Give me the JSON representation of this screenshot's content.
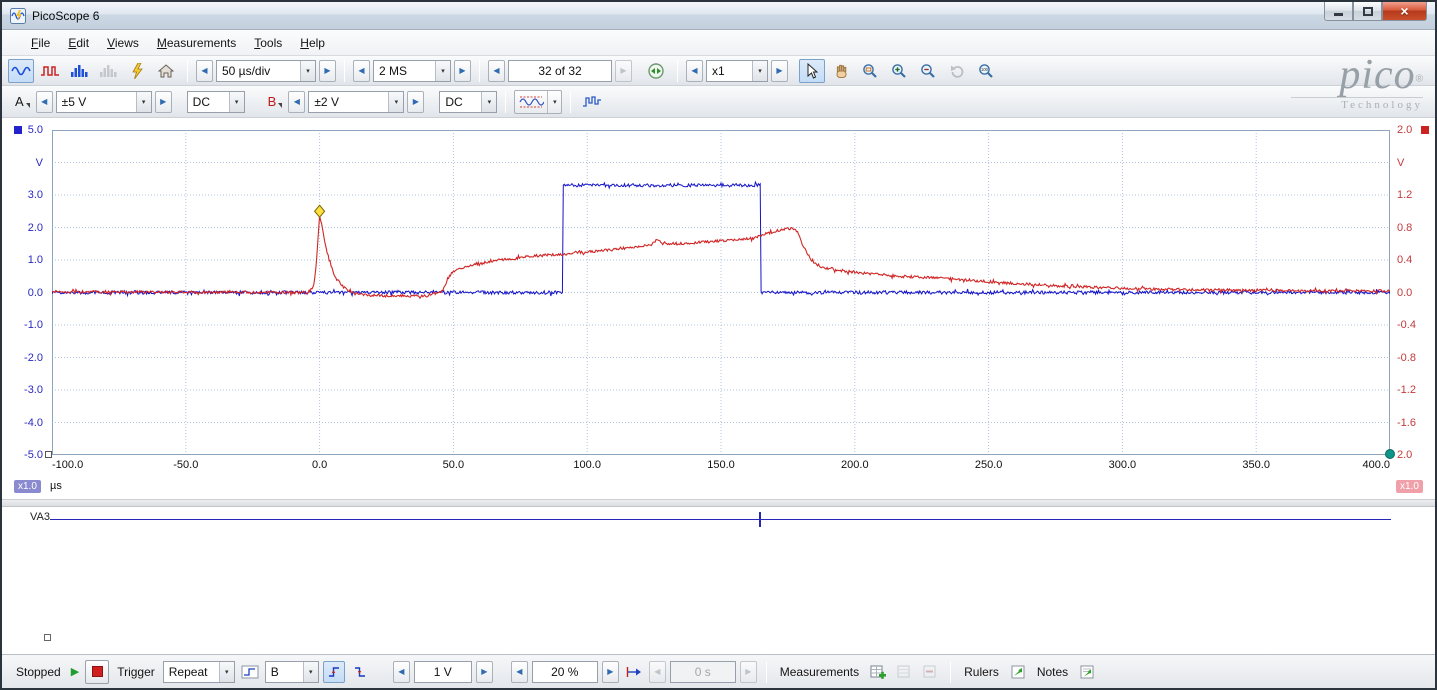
{
  "window": {
    "title": "PicoScope 6"
  },
  "icons": {
    "arrow_left": "◀",
    "arrow_right": "▶",
    "caret_down": "▾",
    "play": "▶",
    "close": "×"
  },
  "menu": {
    "items": [
      {
        "label": "File"
      },
      {
        "label": "Edit"
      },
      {
        "label": "Views"
      },
      {
        "label": "Measurements"
      },
      {
        "label": "Tools"
      },
      {
        "label": "Help"
      }
    ]
  },
  "toolbar": {
    "timebase": "50 µs/div",
    "samples": "2 MS",
    "buffer": "32 of 32",
    "zoom": "x1"
  },
  "channels": {
    "a": {
      "label": "A",
      "range": "±5 V",
      "coupling": "DC"
    },
    "b": {
      "label": "B",
      "range": "±2 V",
      "coupling": "DC"
    }
  },
  "logo": {
    "brand": "pico",
    "reg": "®",
    "sub": "Technology"
  },
  "scope": {
    "x_labels": [
      "-100.0",
      "-50.0",
      "0.0",
      "50.0",
      "100.0",
      "150.0",
      "200.0",
      "250.0",
      "300.0",
      "350.0",
      "400.0"
    ],
    "x_unit": "µs",
    "left_axis_labels": [
      "5.0",
      "V",
      "3.0",
      "2.0",
      "1.0",
      "0.0",
      "-1.0",
      "-2.0",
      "-3.0",
      "-4.0",
      "-5.0"
    ],
    "right_axis_labels": [
      "2.0",
      "V",
      "1.2",
      "0.8",
      "0.4",
      "0.0",
      "-0.4",
      "-0.8",
      "-1.2",
      "-1.6",
      "2.0"
    ],
    "zoom_badge_left": "x1.0",
    "zoom_badge_right": "x1.0"
  },
  "overview": {
    "label": "VA3"
  },
  "bottombar": {
    "status": "Stopped",
    "trigger_label": "Trigger",
    "trigger_mode": "Repeat",
    "trigger_source": "B",
    "trigger_level": "1 V",
    "pretrigger": "20 %",
    "holdoff": "0 s",
    "measurements_label": "Measurements",
    "rulers_label": "Rulers",
    "notes_label": "Notes"
  },
  "chart_data": {
    "type": "line",
    "title": "",
    "x_axis": {
      "label": "µs",
      "min": -100,
      "max": 400,
      "tick_step": 50,
      "divisions": 10
    },
    "y_axis_left": {
      "label": "V",
      "min": -5,
      "max": 5,
      "tick_step": 1,
      "color": "#2222cc"
    },
    "y_axis_right": {
      "label": "V",
      "min": -2,
      "max": 2,
      "tick_step": 0.4,
      "color": "#cc2222"
    },
    "grid": true,
    "series": [
      {
        "name": "Channel A",
        "axis": "left",
        "color": "#1414c8",
        "width": 1,
        "interpolation": "step",
        "noise": 0.05,
        "points": [
          [
            -100,
            0
          ],
          [
            91,
            0
          ],
          [
            91,
            3.3
          ],
          [
            165,
            3.3
          ],
          [
            165,
            0
          ],
          [
            400,
            0
          ]
        ]
      },
      {
        "name": "Channel B",
        "axis": "right",
        "color": "#d02525",
        "width": 1.1,
        "interpolation": "linear",
        "noise": 0.016,
        "points": [
          [
            -100,
            0.01
          ],
          [
            -4,
            0
          ],
          [
            -2,
            0.1
          ],
          [
            -1,
            0.45
          ],
          [
            0,
            0.95
          ],
          [
            1,
            0.8
          ],
          [
            2,
            0.6
          ],
          [
            4,
            0.35
          ],
          [
            6,
            0.18
          ],
          [
            9,
            0.06
          ],
          [
            12,
            0
          ],
          [
            16,
            -0.03
          ],
          [
            25,
            -0.04
          ],
          [
            40,
            -0.04
          ],
          [
            46,
            0.02
          ],
          [
            48,
            0.18
          ],
          [
            50,
            0.26
          ],
          [
            53,
            0.3
          ],
          [
            58,
            0.35
          ],
          [
            68,
            0.4
          ],
          [
            80,
            0.45
          ],
          [
            91,
            0.47
          ],
          [
            106,
            0.52
          ],
          [
            124,
            0.58
          ],
          [
            126,
            0.66
          ],
          [
            128,
            0.6
          ],
          [
            134,
            0.6
          ],
          [
            143,
            0.62
          ],
          [
            152,
            0.64
          ],
          [
            162,
            0.67
          ],
          [
            166,
            0.72
          ],
          [
            170,
            0.75
          ],
          [
            174,
            0.78
          ],
          [
            177,
            0.79
          ],
          [
            179,
            0.72
          ],
          [
            180,
            0.62
          ],
          [
            182,
            0.5
          ],
          [
            184,
            0.38
          ],
          [
            188,
            0.31
          ],
          [
            195,
            0.27
          ],
          [
            205,
            0.23
          ],
          [
            217,
            0.2
          ],
          [
            236,
            0.17
          ],
          [
            255,
            0.12
          ],
          [
            277,
            0.08
          ],
          [
            295,
            0.06
          ],
          [
            311,
            0.04
          ],
          [
            340,
            0.03
          ],
          [
            370,
            0.02
          ],
          [
            400,
            0.02
          ]
        ]
      }
    ],
    "trigger_marker": {
      "x": 0,
      "level": 1,
      "axis": "right",
      "color": "#ffe040"
    }
  }
}
